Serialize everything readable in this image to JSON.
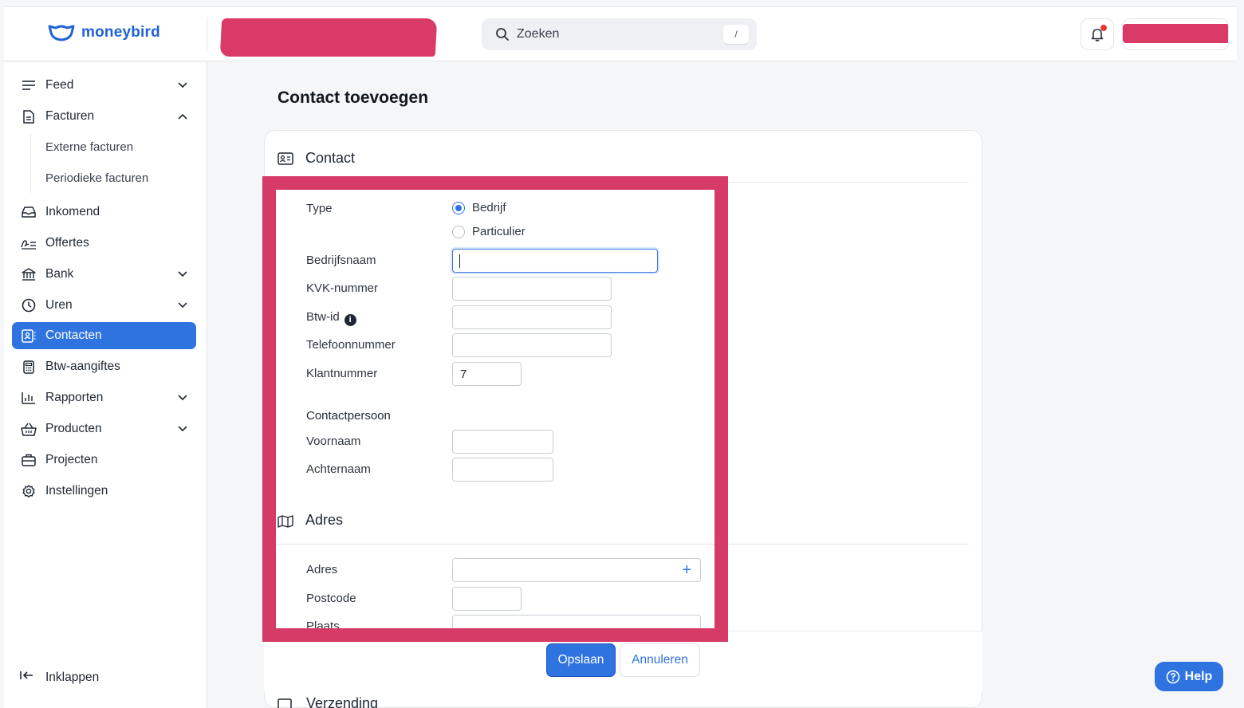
{
  "app": {
    "name": "moneybird"
  },
  "search": {
    "label": "Zoeken",
    "shortcut": "/"
  },
  "sidebar": {
    "items": [
      {
        "label": "Feed",
        "icon": "menu-icon",
        "chevron": "down"
      },
      {
        "label": "Facturen",
        "icon": "document-icon",
        "chevron": "up"
      },
      {
        "label": "Inkomend",
        "icon": "inbox-icon"
      },
      {
        "label": "Offertes",
        "icon": "signature-icon"
      },
      {
        "label": "Bank",
        "icon": "bank-icon",
        "chevron": "down"
      },
      {
        "label": "Uren",
        "icon": "clock-icon",
        "chevron": "down"
      },
      {
        "label": "Contacten",
        "icon": "contact-card-icon",
        "active": true
      },
      {
        "label": "Btw-aangiftes",
        "icon": "calculator-icon"
      },
      {
        "label": "Rapporten",
        "icon": "bar-chart-icon",
        "chevron": "down"
      },
      {
        "label": "Producten",
        "icon": "basket-icon",
        "chevron": "down"
      },
      {
        "label": "Projecten",
        "icon": "briefcase-icon"
      },
      {
        "label": "Instellingen",
        "icon": "gear-icon"
      }
    ],
    "subitems": [
      "Externe facturen",
      "Periodieke facturen"
    ],
    "collapse_label": "Inklappen"
  },
  "page": {
    "title": "Contact toevoegen"
  },
  "form": {
    "section_contact": "Contact",
    "type_label": "Type",
    "type_options": [
      "Bedrijf",
      "Particulier"
    ],
    "type_selected": "Bedrijf",
    "company_label": "Bedrijfsnaam",
    "company_value": "",
    "kvk_label": "KVK-nummer",
    "vat_label": "Btw-id",
    "phone_label": "Telefoonnummer",
    "customer_no_label": "Klantnummer",
    "customer_no_value": "7",
    "contact_person_heading": "Contactpersoon",
    "first_name_label": "Voornaam",
    "last_name_label": "Achternaam",
    "section_address": "Adres",
    "address_label": "Adres",
    "postcode_label": "Postcode",
    "city_label": "Plaats",
    "section_shipping": "Verzending"
  },
  "actions": {
    "save": "Opslaan",
    "cancel": "Annuleren"
  },
  "help": {
    "label": "Help"
  },
  "colors": {
    "accent": "#2f73e0",
    "annotation": "#d63a67",
    "notification": "#e53935"
  }
}
